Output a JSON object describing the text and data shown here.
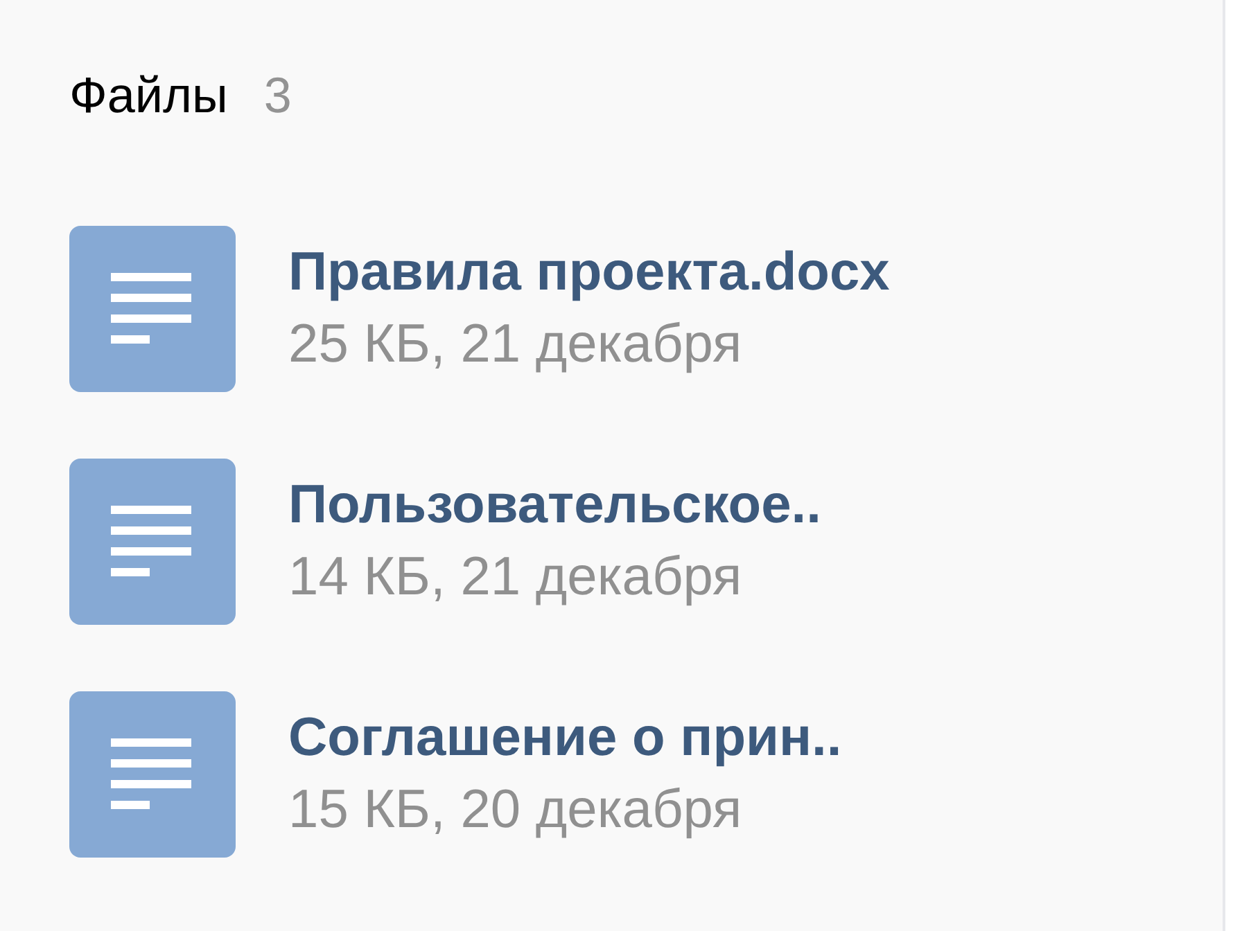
{
  "header": {
    "title": "Файлы",
    "count": "3"
  },
  "files": [
    {
      "name": "Правила проекта.docx",
      "meta": "25 КБ, 21 декабря"
    },
    {
      "name": "Пользовательское..",
      "meta": "14 КБ, 21 декабря"
    },
    {
      "name": "Соглашение о прин..",
      "meta": "15 КБ, 20 декабря"
    }
  ]
}
